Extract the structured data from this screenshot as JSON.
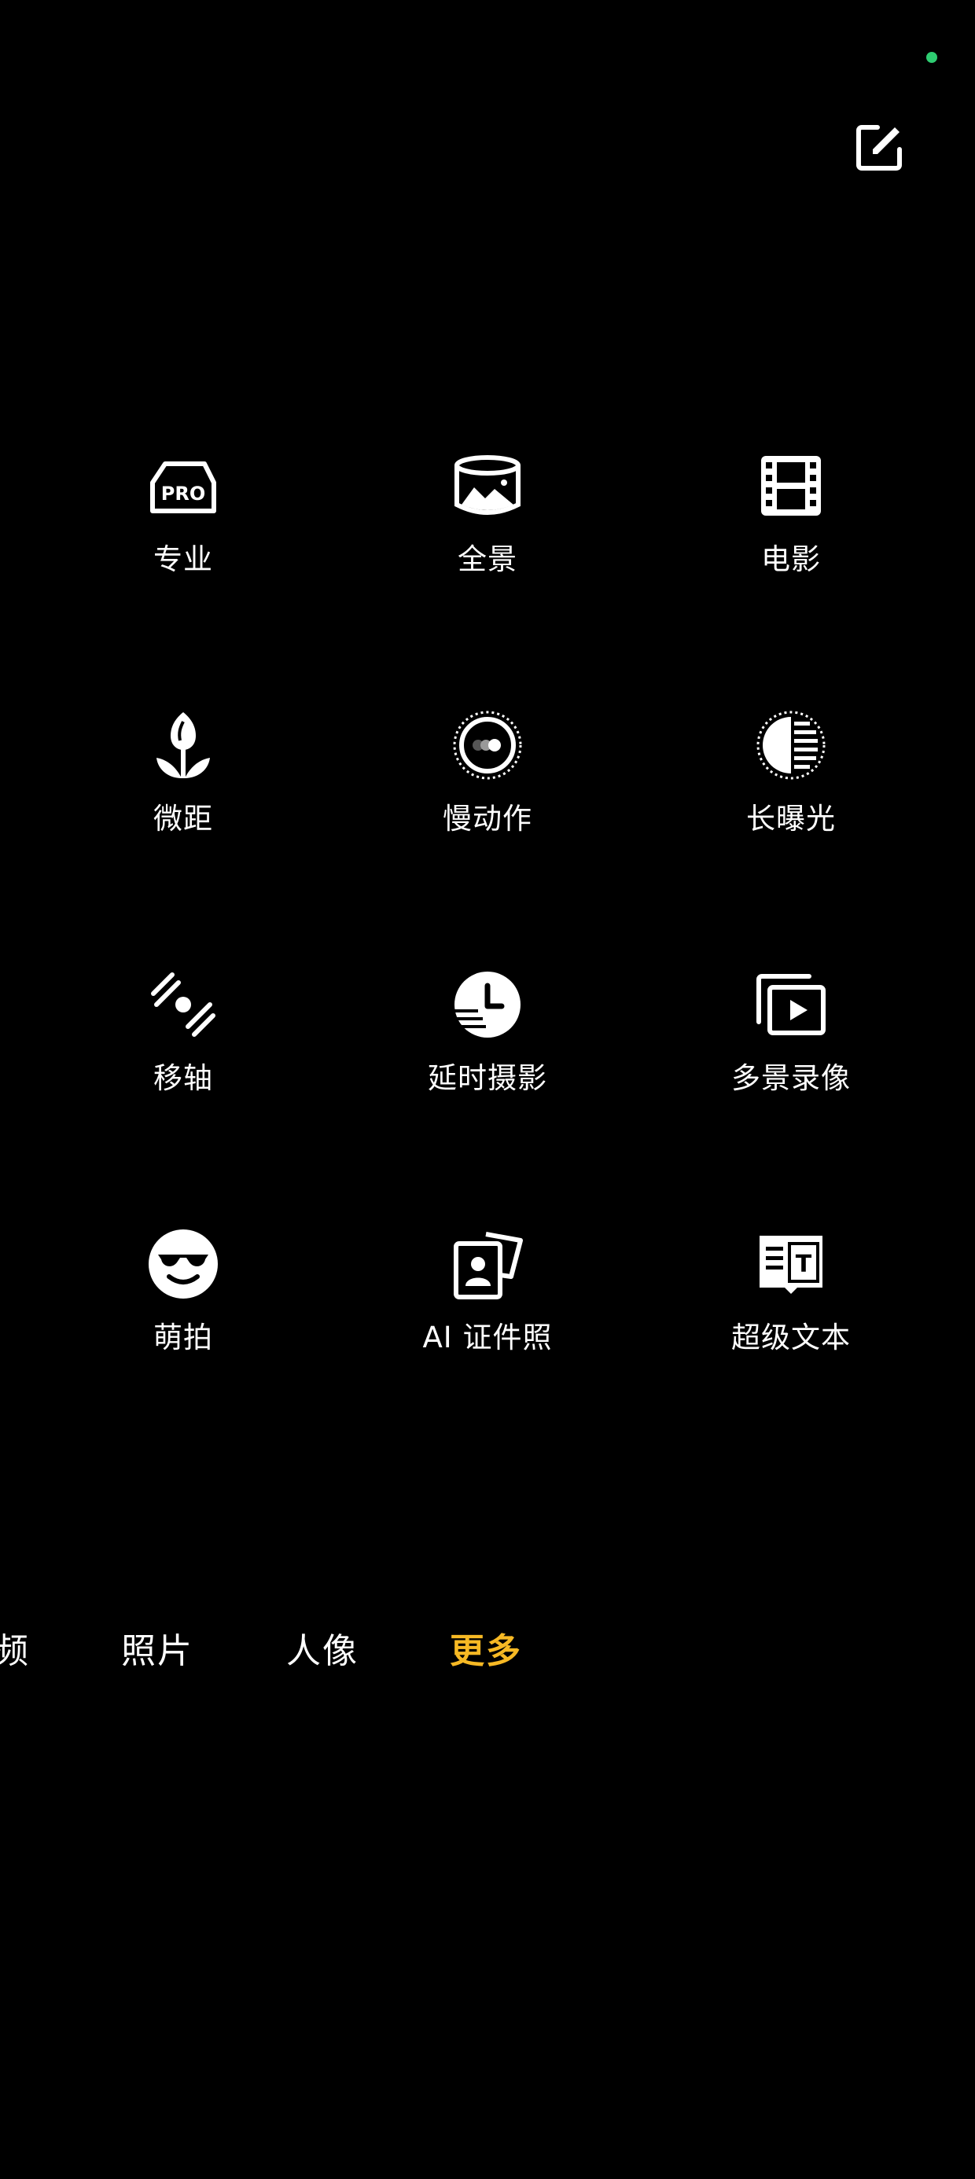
{
  "status": {
    "indicator_color": "#2ecc71"
  },
  "header": {
    "edit_icon": "edit-icon"
  },
  "modes": [
    {
      "label": "专业",
      "icon": "pro-camera-icon",
      "icon_text": "PRO"
    },
    {
      "label": "全景",
      "icon": "panorama-icon"
    },
    {
      "label": "电影",
      "icon": "film-icon"
    },
    {
      "label": "微距",
      "icon": "tulip-icon"
    },
    {
      "label": "慢动作",
      "icon": "slow-motion-icon"
    },
    {
      "label": "长曝光",
      "icon": "long-exposure-icon"
    },
    {
      "label": "移轴",
      "icon": "tilt-shift-icon"
    },
    {
      "label": "延时摄影",
      "icon": "timelapse-icon"
    },
    {
      "label": "多景录像",
      "icon": "multi-scene-video-icon"
    },
    {
      "label": "萌拍",
      "icon": "sunglasses-face-icon"
    },
    {
      "label": "AI 证件照",
      "icon": "id-photo-icon"
    },
    {
      "label": "超级文本",
      "icon": "super-text-icon",
      "icon_text": "T"
    }
  ],
  "bottom_tabs": [
    {
      "label": "频",
      "active": false
    },
    {
      "label": "照片",
      "active": false
    },
    {
      "label": "人像",
      "active": false
    },
    {
      "label": "更多",
      "active": true
    }
  ],
  "colors": {
    "accent": "#f7b924",
    "background": "#000000",
    "text": "#ffffff"
  }
}
